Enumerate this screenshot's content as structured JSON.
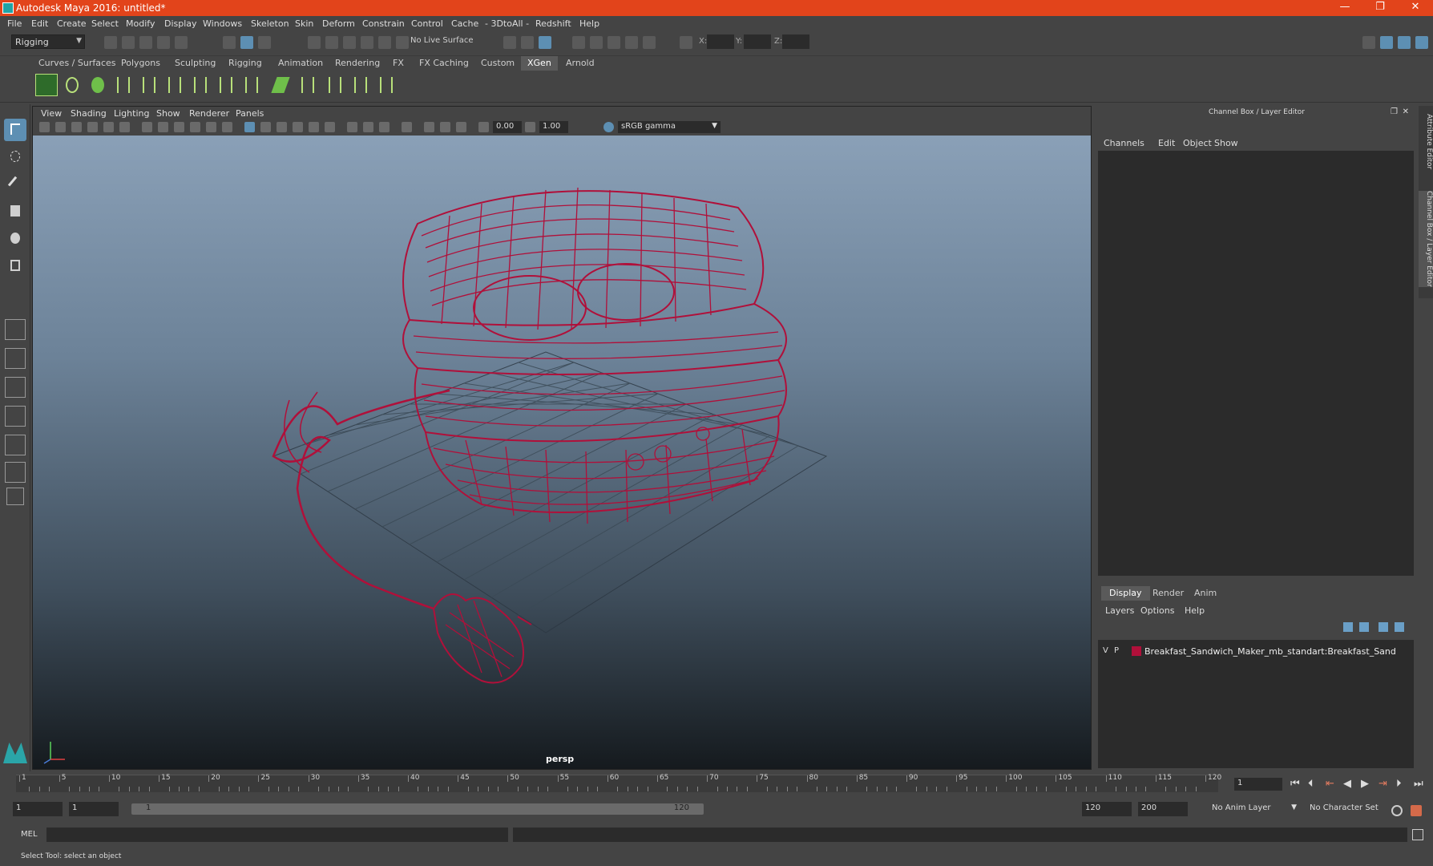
{
  "window": {
    "title": "Autodesk Maya 2016: untitled*",
    "minimize": "—",
    "maximize": "❐",
    "close": "✕"
  },
  "menubar": [
    "File",
    "Edit",
    "Create",
    "Select",
    "Modify",
    "Display",
    "Windows",
    "Skeleton",
    "Skin",
    "Deform",
    "Constrain",
    "Control",
    "Cache",
    "- 3DtoAll -",
    "Redshift",
    "Help"
  ],
  "statusline": {
    "mode": "Rigging",
    "live_surface": "No Live Surface",
    "x_label": "X:",
    "y_label": "Y:",
    "z_label": "Z:"
  },
  "shelf_tabs": [
    "Curves / Surfaces",
    "Polygons",
    "Sculpting",
    "Rigging",
    "Animation",
    "Rendering",
    "FX",
    "FX Caching",
    "Custom",
    "XGen",
    "Arnold"
  ],
  "active_shelf": "XGen",
  "viewport": {
    "menu": [
      "View",
      "Shading",
      "Lighting",
      "Show",
      "Renderer",
      "Panels"
    ],
    "exposure": "0.00",
    "gamma": "1.00",
    "color_space": "sRGB gamma",
    "camera": "persp"
  },
  "right_panel": {
    "title": "Channel Box / Layer Editor",
    "menu": [
      "Channels",
      "Edit",
      "Object",
      "Show"
    ],
    "tabs": [
      "Display",
      "Render",
      "Anim"
    ],
    "active_tab": "Display",
    "layer_menu": [
      "Layers",
      "Options",
      "Help"
    ],
    "layers": [
      {
        "visible": "V",
        "playback": "P",
        "name": "Breakfast_Sandwich_Maker_mb_standart:Breakfast_Sand",
        "color": "#b0103a"
      }
    ],
    "side_tabs": [
      "Attribute Editor",
      "Channel Box / Layer Editor"
    ]
  },
  "timeline": {
    "ticks": [
      1,
      5,
      10,
      15,
      20,
      25,
      30,
      35,
      40,
      45,
      50,
      55,
      60,
      65,
      70,
      75,
      80,
      85,
      90,
      95,
      100,
      105,
      110,
      115,
      120
    ],
    "current_frame": "1"
  },
  "range": {
    "start": "1",
    "playback_start": "1",
    "slider_start": "1",
    "slider_end": "120",
    "playback_end": "120",
    "end": "200",
    "anim_layer": "No Anim Layer",
    "character_set": "No Character Set"
  },
  "command_line": {
    "label": "MEL"
  },
  "help_line": "Select Tool: select an object",
  "colors": {
    "titlebar": "#e2441b",
    "wireframe": "#b0103a",
    "selected": "#5d8fb3"
  }
}
